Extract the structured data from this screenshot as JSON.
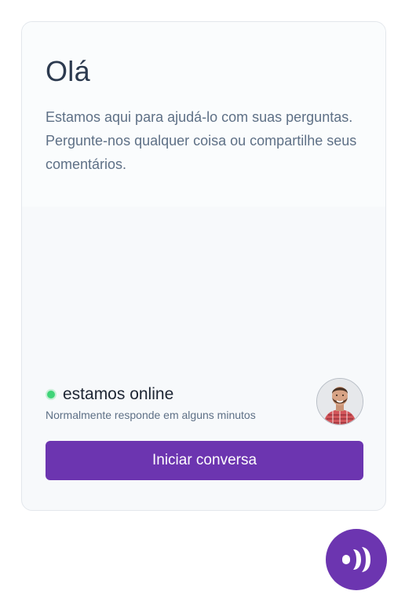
{
  "widget": {
    "title": "Olá",
    "message": "Estamos aqui para ajudá-lo com suas perguntas. Pergunte-nos qualquer coisa ou compartilhe seus comentários.",
    "status": {
      "label": "estamos online",
      "response_time": "Normalmente responde em alguns minutos",
      "color": "#3fd478"
    },
    "cta_label": "Iniciar conversa",
    "accent_color": "#6c35b0"
  },
  "launcher": {
    "icon": "chat-logo-icon"
  }
}
